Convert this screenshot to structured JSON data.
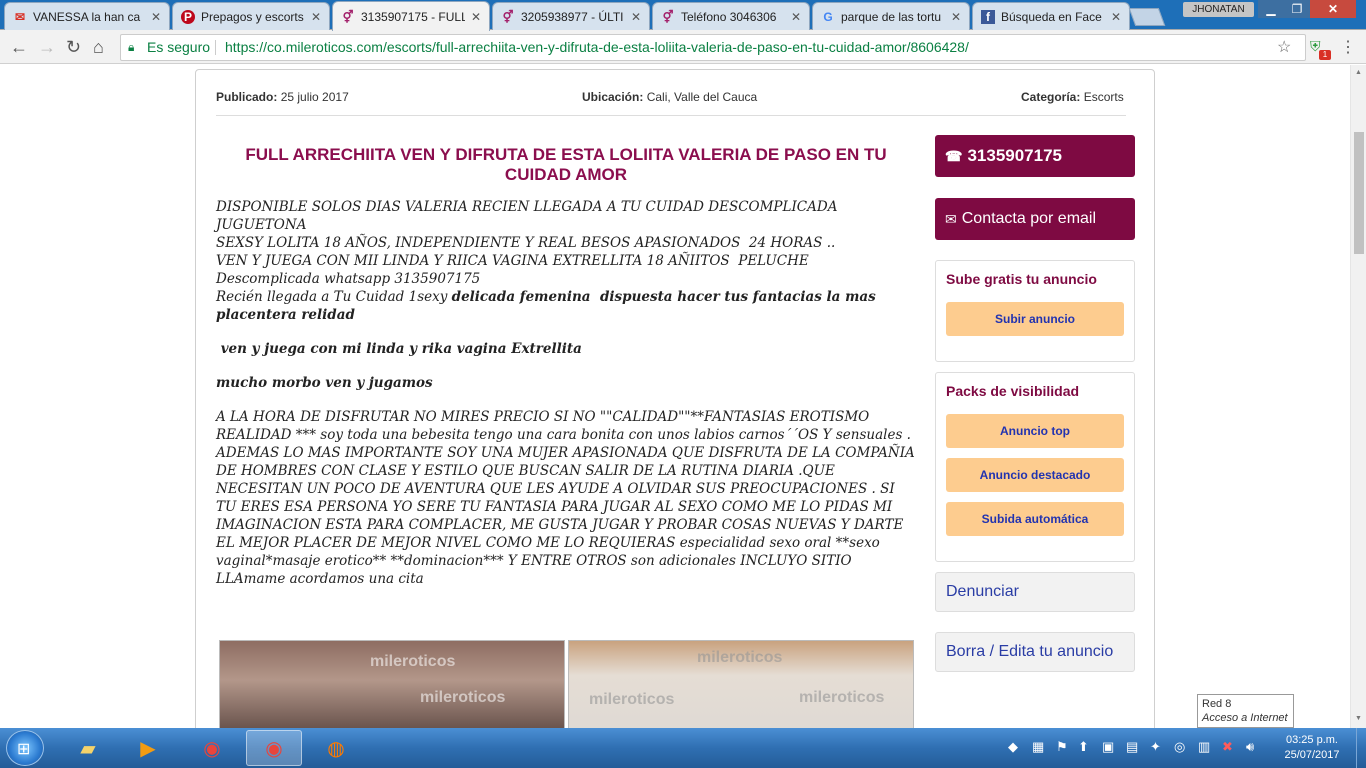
{
  "browser": {
    "tabs": [
      {
        "label": "VANESSA la han ca",
        "icon": "mail-icon",
        "active": false
      },
      {
        "label": "Prepagos y escorts",
        "icon": "pinterest-icon",
        "active": false
      },
      {
        "label": "3135907175 - FULL",
        "icon": "gender-icon",
        "active": true
      },
      {
        "label": "3205938977 - ÚLTI",
        "icon": "gender-icon",
        "active": false
      },
      {
        "label": "Teléfono 3046306",
        "icon": "gender-icon",
        "active": false
      },
      {
        "label": "parque de las tortu",
        "icon": "google-icon",
        "active": false
      },
      {
        "label": "Búsqueda en Face",
        "icon": "facebook-icon",
        "active": false
      }
    ],
    "user": "JHONATAN",
    "secure_label": "Es seguro",
    "url": "https://co.mileroticos.com/escorts/full-arrechiita-ven-y-difruta-de-esta-loliita-valeria-de-paso-en-tu-cuidad-amor/8606428/",
    "ext_badge": "1"
  },
  "ad": {
    "published_label": "Publicado:",
    "published": "25 julio 2017",
    "location_label": "Ubicación:",
    "location": "Cali, Valle del Cauca",
    "category_label": "Categoría:",
    "category": "Escorts",
    "title": "FULL ARRECHIITA VEN Y DIFRUTA DE ESTA LOLIITA VALERIA DE PASO EN TU CUIDAD AMOR",
    "body_lines": {
      "l1": "DISPONIBLE SOLOS DIAS VALERIA RECIEN LLEGADA A TU CUIDAD DESCOMPLICADA JUGUETONA",
      "l2": "SEXSY LOLITA 18 AÑOS, INDEPENDIENTE Y REAL BESOS APASIONADOS  24 HORAS ..",
      "l3": "VEN Y JUEGA CON MII LINDA Y RIICA VAGINA EXTRELLITA 18 AÑIITOS  PELUCHE",
      "l4": "Descomplicada whatsapp 3135907175",
      "l5a": "Recién llegada a Tu Cuidad 1sexy ",
      "l5b": "delicada femenina  dispuesta hacer tus fantacias la mas placentera relidad",
      "l6": " ven y juega con mi linda y rika vagina Extrellita",
      "l7": "mucho morbo ven y jugamos",
      "l8": "A LA HORA DE DISFRUTAR NO MIRES PRECIO SI NO \"\"CALIDAD\"\"**FANTASIAS EROTISMO REALIDAD *** soy toda una bebesita tengo una cara bonita con unos labios carnos´´OS Y sensuales .",
      "l9": "ADEMAS LO MAS IMPORTANTE SOY UNA MUJER APASIONADA QUE DISFRUTA DE LA COMPAÑIA DE HOMBRES CON CLASE Y ESTILO QUE BUSCAN SALIR DE LA RUTINA DIARIA .QUE NECESITAN UN POCO DE AVENTURA QUE LES AYUDE A OLVIDAR SUS PREOCUPACIONES . SI TU ERES ESA PERSONA YO SERE TU FANTASIA PARA JUGAR AL SEXO COMO ME LO PIDAS MI IMAGINACION ESTA PARA COMPLACER, ME GUSTA JUGAR Y PROBAR COSAS NUEVAS Y DARTE EL MEJOR PLACER DE MEJOR NIVEL COMO ME LO REQUIERAS especialidad sexo oral **sexo vaginal*masaje erotico** **dominacion*** Y ENTRE OTROS son adicionales INCLUYO SITIO  LLAmame acordamos una cita"
    },
    "watermark": "mileroticos"
  },
  "sidebar": {
    "phone": "3135907175",
    "email_label": "Contacta por email",
    "box1_title": "Sube gratis tu anuncio",
    "box1_button": "Subir anuncio",
    "box2_title": "Packs de visibilidad",
    "box2_buttons": [
      "Anuncio top",
      "Anuncio destacado",
      "Subida automática"
    ],
    "report": "Denunciar",
    "edit": "Borra / Edita tu anuncio"
  },
  "network_popup": {
    "line1": "Red  8",
    "line2": "Acceso a Internet"
  },
  "taskbar": {
    "time": "03:25 p.m.",
    "date": "25/07/2017"
  },
  "colors": {
    "accent": "#7e0a42",
    "title": "#8b0e4e",
    "pack_button": "#fdcc8f",
    "link": "#2a3da5",
    "secure": "#0b8043"
  }
}
